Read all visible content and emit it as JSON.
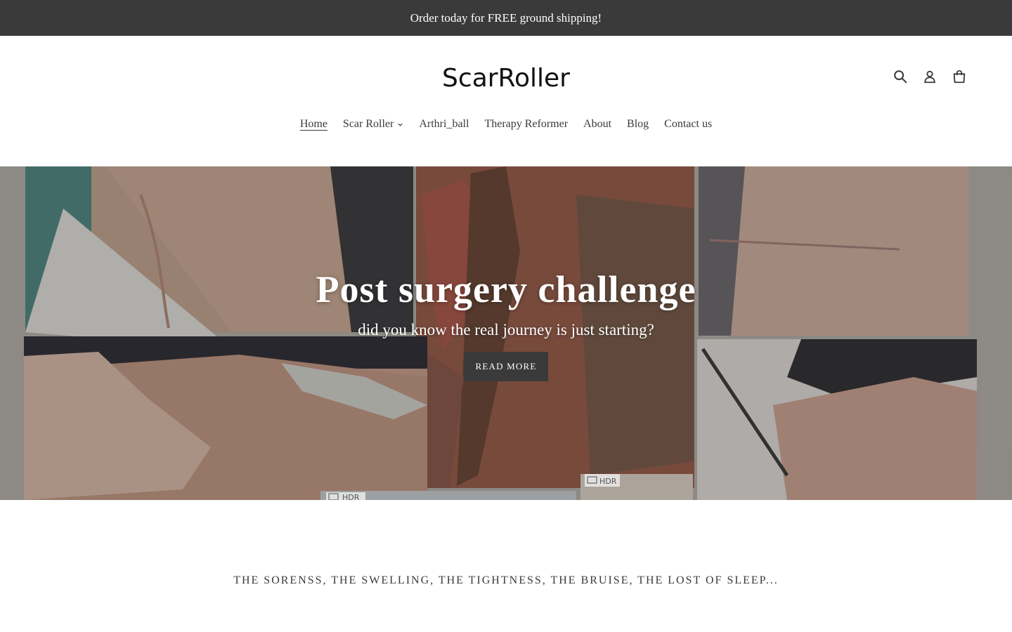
{
  "announcement": {
    "text": "Order today for FREE ground shipping!"
  },
  "header": {
    "logo_text": "ScarRoller",
    "icons": [
      "search-icon",
      "account-icon",
      "cart-icon"
    ]
  },
  "nav": {
    "items": [
      {
        "label": "Home",
        "active": true
      },
      {
        "label": "Scar Roller",
        "dropdown": true
      },
      {
        "label": "Arthri_ball"
      },
      {
        "label": "Therapy Reformer"
      },
      {
        "label": "About"
      },
      {
        "label": "Blog"
      },
      {
        "label": "Contact us"
      }
    ]
  },
  "hero": {
    "title": "Post surgery challenge",
    "subtitle": "did you know the real journey is just starting?",
    "button_label": "READ MORE",
    "photo_labels": [
      "HDR",
      "HDR"
    ]
  },
  "tagline": "THE SORENSS, THE SWELLING, THE TIGHTNESS, THE BRUISE, THE LOST OF SLEEP...",
  "colors": {
    "announcement_bg": "#3a3a3a",
    "button_bg": "#3a3a3a",
    "text": "#3a3a3a"
  }
}
